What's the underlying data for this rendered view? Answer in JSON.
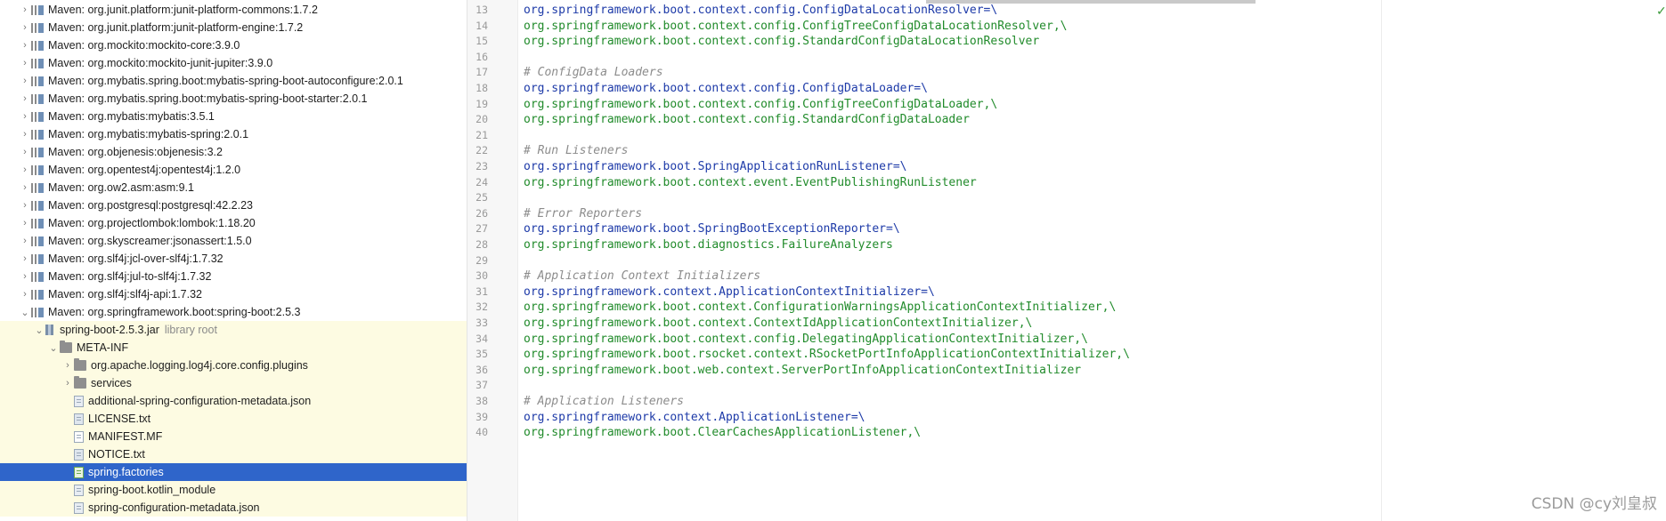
{
  "tree": {
    "rows": [
      {
        "indent": 0,
        "arrow": "right",
        "icon": "maven",
        "label": "Maven: org.junit.platform:junit-platform-commons:1.7.2",
        "sub": ""
      },
      {
        "indent": 0,
        "arrow": "right",
        "icon": "maven",
        "label": "Maven: org.junit.platform:junit-platform-engine:1.7.2",
        "sub": ""
      },
      {
        "indent": 0,
        "arrow": "right",
        "icon": "maven",
        "label": "Maven: org.mockito:mockito-core:3.9.0",
        "sub": ""
      },
      {
        "indent": 0,
        "arrow": "right",
        "icon": "maven",
        "label": "Maven: org.mockito:mockito-junit-jupiter:3.9.0",
        "sub": ""
      },
      {
        "indent": 0,
        "arrow": "right",
        "icon": "maven",
        "label": "Maven: org.mybatis.spring.boot:mybatis-spring-boot-autoconfigure:2.0.1",
        "sub": ""
      },
      {
        "indent": 0,
        "arrow": "right",
        "icon": "maven",
        "label": "Maven: org.mybatis.spring.boot:mybatis-spring-boot-starter:2.0.1",
        "sub": ""
      },
      {
        "indent": 0,
        "arrow": "right",
        "icon": "maven",
        "label": "Maven: org.mybatis:mybatis:3.5.1",
        "sub": ""
      },
      {
        "indent": 0,
        "arrow": "right",
        "icon": "maven",
        "label": "Maven: org.mybatis:mybatis-spring:2.0.1",
        "sub": ""
      },
      {
        "indent": 0,
        "arrow": "right",
        "icon": "maven",
        "label": "Maven: org.objenesis:objenesis:3.2",
        "sub": ""
      },
      {
        "indent": 0,
        "arrow": "right",
        "icon": "maven",
        "label": "Maven: org.opentest4j:opentest4j:1.2.0",
        "sub": ""
      },
      {
        "indent": 0,
        "arrow": "right",
        "icon": "maven",
        "label": "Maven: org.ow2.asm:asm:9.1",
        "sub": ""
      },
      {
        "indent": 0,
        "arrow": "right",
        "icon": "maven",
        "label": "Maven: org.postgresql:postgresql:42.2.23",
        "sub": ""
      },
      {
        "indent": 0,
        "arrow": "right",
        "icon": "maven",
        "label": "Maven: org.projectlombok:lombok:1.18.20",
        "sub": ""
      },
      {
        "indent": 0,
        "arrow": "right",
        "icon": "maven",
        "label": "Maven: org.skyscreamer:jsonassert:1.5.0",
        "sub": ""
      },
      {
        "indent": 0,
        "arrow": "right",
        "icon": "maven",
        "label": "Maven: org.slf4j:jcl-over-slf4j:1.7.32",
        "sub": ""
      },
      {
        "indent": 0,
        "arrow": "right",
        "icon": "maven",
        "label": "Maven: org.slf4j:jul-to-slf4j:1.7.32",
        "sub": ""
      },
      {
        "indent": 0,
        "arrow": "right",
        "icon": "maven",
        "label": "Maven: org.slf4j:slf4j-api:1.7.32",
        "sub": ""
      },
      {
        "indent": 0,
        "arrow": "down",
        "icon": "maven",
        "label": "Maven: org.springframework.boot:spring-boot:2.5.3",
        "sub": ""
      },
      {
        "indent": 1,
        "arrow": "down",
        "icon": "jar",
        "label": "spring-boot-2.5.3.jar",
        "sub": "library root",
        "lib": true
      },
      {
        "indent": 2,
        "arrow": "down",
        "icon": "folder",
        "label": "META-INF",
        "sub": "",
        "lib": true
      },
      {
        "indent": 3,
        "arrow": "right",
        "icon": "folder",
        "label": "org.apache.logging.log4j.core.config.plugins",
        "sub": "",
        "lib": true
      },
      {
        "indent": 3,
        "arrow": "right",
        "icon": "folder",
        "label": "services",
        "sub": "",
        "lib": true
      },
      {
        "indent": 3,
        "arrow": "none",
        "icon": "file",
        "label": "additional-spring-configuration-metadata.json",
        "sub": "",
        "lib": true
      },
      {
        "indent": 3,
        "arrow": "none",
        "icon": "txt",
        "label": "LICENSE.txt",
        "sub": "",
        "lib": true
      },
      {
        "indent": 3,
        "arrow": "none",
        "icon": "mf",
        "label": "MANIFEST.MF",
        "sub": "",
        "lib": true
      },
      {
        "indent": 3,
        "arrow": "none",
        "icon": "txt",
        "label": "NOTICE.txt",
        "sub": "",
        "lib": true
      },
      {
        "indent": 3,
        "arrow": "none",
        "icon": "factories",
        "label": "spring.factories",
        "sub": "",
        "lib": true,
        "selected": true
      },
      {
        "indent": 3,
        "arrow": "none",
        "icon": "file",
        "label": "spring-boot.kotlin_module",
        "sub": "",
        "lib": true
      },
      {
        "indent": 3,
        "arrow": "none",
        "icon": "file",
        "label": "spring-configuration-metadata.json",
        "sub": "",
        "lib": true
      }
    ]
  },
  "editor": {
    "lines": [
      {
        "n": "13",
        "type": "key",
        "text": "org.springframework.boot.context.config.ConfigDataLocationResolver=\\"
      },
      {
        "n": "14",
        "type": "val",
        "text": "org.springframework.boot.context.config.ConfigTreeConfigDataLocationResolver,\\"
      },
      {
        "n": "15",
        "type": "val",
        "text": "org.springframework.boot.context.config.StandardConfigDataLocationResolver"
      },
      {
        "n": "16",
        "type": "blank",
        "text": ""
      },
      {
        "n": "17",
        "type": "comment",
        "text": "# ConfigData Loaders"
      },
      {
        "n": "18",
        "type": "key",
        "text": "org.springframework.boot.context.config.ConfigDataLoader=\\"
      },
      {
        "n": "19",
        "type": "val",
        "text": "org.springframework.boot.context.config.ConfigTreeConfigDataLoader,\\"
      },
      {
        "n": "20",
        "type": "val",
        "text": "org.springframework.boot.context.config.StandardConfigDataLoader"
      },
      {
        "n": "21",
        "type": "blank",
        "text": ""
      },
      {
        "n": "22",
        "type": "comment",
        "text": "# Run Listeners"
      },
      {
        "n": "23",
        "type": "key",
        "text": "org.springframework.boot.SpringApplicationRunListener=\\"
      },
      {
        "n": "24",
        "type": "val",
        "text": "org.springframework.boot.context.event.EventPublishingRunListener"
      },
      {
        "n": "25",
        "type": "blank",
        "text": ""
      },
      {
        "n": "26",
        "type": "comment",
        "text": "# Error Reporters"
      },
      {
        "n": "27",
        "type": "key",
        "text": "org.springframework.boot.SpringBootExceptionReporter=\\"
      },
      {
        "n": "28",
        "type": "val",
        "text": "org.springframework.boot.diagnostics.FailureAnalyzers"
      },
      {
        "n": "29",
        "type": "blank",
        "text": ""
      },
      {
        "n": "30",
        "type": "comment",
        "text": "# Application Context Initializers"
      },
      {
        "n": "31",
        "type": "key",
        "text": "org.springframework.context.ApplicationContextInitializer=\\"
      },
      {
        "n": "32",
        "type": "val",
        "text": "org.springframework.boot.context.ConfigurationWarningsApplicationContextInitializer,\\"
      },
      {
        "n": "33",
        "type": "val",
        "text": "org.springframework.boot.context.ContextIdApplicationContextInitializer,\\"
      },
      {
        "n": "34",
        "type": "val",
        "text": "org.springframework.boot.context.config.DelegatingApplicationContextInitializer,\\"
      },
      {
        "n": "35",
        "type": "val",
        "text": "org.springframework.boot.rsocket.context.RSocketPortInfoApplicationContextInitializer,\\"
      },
      {
        "n": "36",
        "type": "val",
        "text": "org.springframework.boot.web.context.ServerPortInfoApplicationContextInitializer"
      },
      {
        "n": "37",
        "type": "blank",
        "text": ""
      },
      {
        "n": "38",
        "type": "comment",
        "text": "# Application Listeners"
      },
      {
        "n": "39",
        "type": "key",
        "text": "org.springframework.context.ApplicationListener=\\"
      },
      {
        "n": "40",
        "type": "val",
        "text": "org.springframework.boot.ClearCachesApplicationListener,\\"
      }
    ],
    "check_mark": "✓"
  },
  "watermark": "CSDN @cy刘皇叔"
}
